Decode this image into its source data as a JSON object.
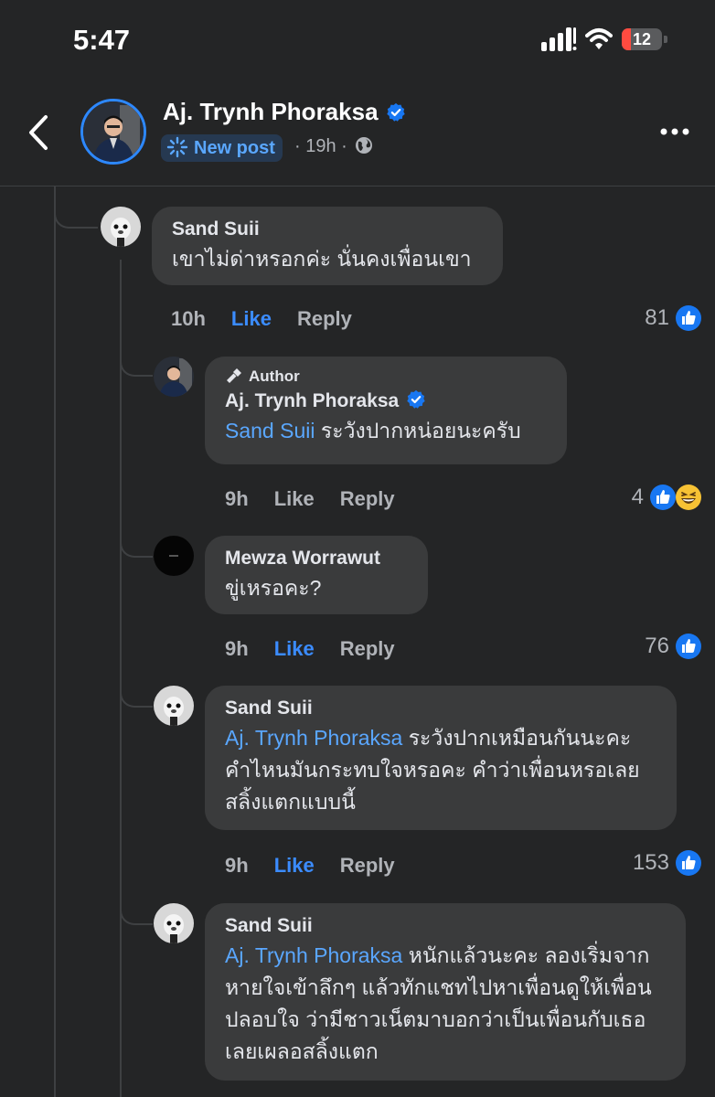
{
  "status_bar": {
    "time": "5:47",
    "battery": "12"
  },
  "header": {
    "name": "Aj. Trynh Phoraksa",
    "badge": "New post",
    "meta": "· 19h ·"
  },
  "comments": [
    {
      "name": "Sand Suii",
      "text": "เขาไม่ด่าหรอกค่ะ นั่นคงเพื่อนเขา",
      "time": "10h",
      "like": "Like",
      "reply": "Reply",
      "reactions": "81"
    },
    {
      "author_tag": "Author",
      "name": "Aj. Trynh Phoraksa",
      "mention": "Sand Suii",
      "text": " ระวังปากหน่อยนะครับ",
      "time": "9h",
      "like": "Like",
      "reply": "Reply",
      "reactions": "4"
    },
    {
      "name": "Mewza Worrawut",
      "text": "ขู่เหรอคะ?",
      "time": "9h",
      "like": "Like",
      "reply": "Reply",
      "reactions": "76"
    },
    {
      "name": "Sand Suii",
      "mention": "Aj. Trynh Phoraksa",
      "text": " ระวังปากเหมือนกันนะคะ คำไหนมันกระทบใจหรอคะ คำว่าเพื่อนหรอเลยสลิ้งแตกแบบนี้",
      "time": "9h",
      "like": "Like",
      "reply": "Reply",
      "reactions": "153"
    },
    {
      "name": "Sand Suii",
      "mention": "Aj. Trynh Phoraksa",
      "text": " หนักแล้วนะคะ ลองเริ่มจากหายใจเข้าลึกๆ แล้วทักแชทไปหาเพื่อนดูให้เพื่อนปลอบใจ ว่ามีชาวเน็ตมาบอกว่าเป็นเพื่อนกับเธอเลยเผลอสลิ้งแตก"
    }
  ],
  "colors": {
    "background": "#242526",
    "bubble": "#3a3b3c",
    "accent": "#3b8cff",
    "mention": "#5aa7ff"
  }
}
